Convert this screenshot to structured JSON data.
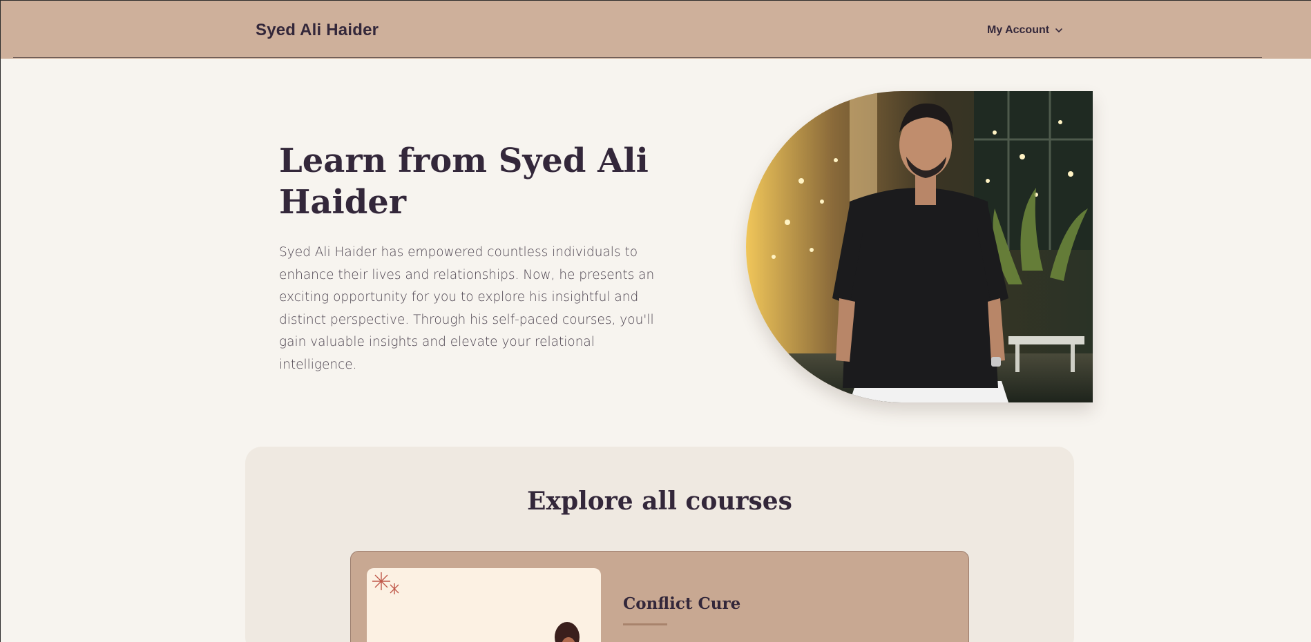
{
  "header": {
    "brand": "Syed Ali Haider",
    "account_label": "My Account",
    "account_icon": "chevron-down-icon",
    "background_color": "#ceb09b"
  },
  "hero": {
    "title": "Learn from Syed Ali Haider",
    "description": "Syed Ali Haider has empowered countless individuals to enhance their lives and relationships. Now, he presents an exciting opportunity for you to explore his insightful and distinct perspective. Through his self-paced courses, you'll gain valuable insights and elevate your relational intelligence."
  },
  "courses": {
    "section_title": "Explore all courses",
    "items": [
      {
        "name": "Conflict Cure"
      }
    ]
  },
  "colors": {
    "page_background": "#f7f4ef",
    "panel_background": "#efe9e1",
    "card_background": "#c8a892",
    "text_primary": "#33273a"
  }
}
